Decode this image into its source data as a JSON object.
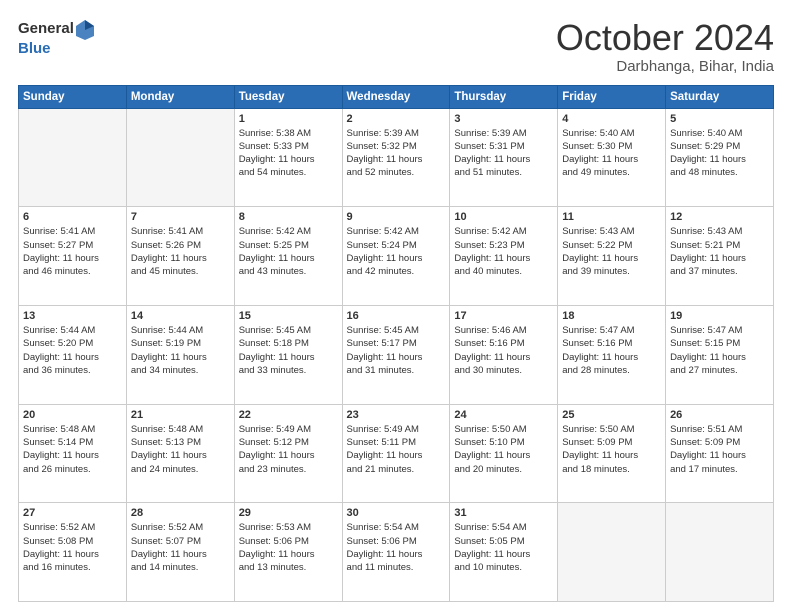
{
  "header": {
    "logo_general": "General",
    "logo_blue": "Blue",
    "month": "October 2024",
    "location": "Darbhanga, Bihar, India"
  },
  "weekdays": [
    "Sunday",
    "Monday",
    "Tuesday",
    "Wednesday",
    "Thursday",
    "Friday",
    "Saturday"
  ],
  "weeks": [
    [
      {
        "day": "",
        "info": ""
      },
      {
        "day": "",
        "info": ""
      },
      {
        "day": "1",
        "info": "Sunrise: 5:38 AM\nSunset: 5:33 PM\nDaylight: 11 hours\nand 54 minutes."
      },
      {
        "day": "2",
        "info": "Sunrise: 5:39 AM\nSunset: 5:32 PM\nDaylight: 11 hours\nand 52 minutes."
      },
      {
        "day": "3",
        "info": "Sunrise: 5:39 AM\nSunset: 5:31 PM\nDaylight: 11 hours\nand 51 minutes."
      },
      {
        "day": "4",
        "info": "Sunrise: 5:40 AM\nSunset: 5:30 PM\nDaylight: 11 hours\nand 49 minutes."
      },
      {
        "day": "5",
        "info": "Sunrise: 5:40 AM\nSunset: 5:29 PM\nDaylight: 11 hours\nand 48 minutes."
      }
    ],
    [
      {
        "day": "6",
        "info": "Sunrise: 5:41 AM\nSunset: 5:27 PM\nDaylight: 11 hours\nand 46 minutes."
      },
      {
        "day": "7",
        "info": "Sunrise: 5:41 AM\nSunset: 5:26 PM\nDaylight: 11 hours\nand 45 minutes."
      },
      {
        "day": "8",
        "info": "Sunrise: 5:42 AM\nSunset: 5:25 PM\nDaylight: 11 hours\nand 43 minutes."
      },
      {
        "day": "9",
        "info": "Sunrise: 5:42 AM\nSunset: 5:24 PM\nDaylight: 11 hours\nand 42 minutes."
      },
      {
        "day": "10",
        "info": "Sunrise: 5:42 AM\nSunset: 5:23 PM\nDaylight: 11 hours\nand 40 minutes."
      },
      {
        "day": "11",
        "info": "Sunrise: 5:43 AM\nSunset: 5:22 PM\nDaylight: 11 hours\nand 39 minutes."
      },
      {
        "day": "12",
        "info": "Sunrise: 5:43 AM\nSunset: 5:21 PM\nDaylight: 11 hours\nand 37 minutes."
      }
    ],
    [
      {
        "day": "13",
        "info": "Sunrise: 5:44 AM\nSunset: 5:20 PM\nDaylight: 11 hours\nand 36 minutes."
      },
      {
        "day": "14",
        "info": "Sunrise: 5:44 AM\nSunset: 5:19 PM\nDaylight: 11 hours\nand 34 minutes."
      },
      {
        "day": "15",
        "info": "Sunrise: 5:45 AM\nSunset: 5:18 PM\nDaylight: 11 hours\nand 33 minutes."
      },
      {
        "day": "16",
        "info": "Sunrise: 5:45 AM\nSunset: 5:17 PM\nDaylight: 11 hours\nand 31 minutes."
      },
      {
        "day": "17",
        "info": "Sunrise: 5:46 AM\nSunset: 5:16 PM\nDaylight: 11 hours\nand 30 minutes."
      },
      {
        "day": "18",
        "info": "Sunrise: 5:47 AM\nSunset: 5:16 PM\nDaylight: 11 hours\nand 28 minutes."
      },
      {
        "day": "19",
        "info": "Sunrise: 5:47 AM\nSunset: 5:15 PM\nDaylight: 11 hours\nand 27 minutes."
      }
    ],
    [
      {
        "day": "20",
        "info": "Sunrise: 5:48 AM\nSunset: 5:14 PM\nDaylight: 11 hours\nand 26 minutes."
      },
      {
        "day": "21",
        "info": "Sunrise: 5:48 AM\nSunset: 5:13 PM\nDaylight: 11 hours\nand 24 minutes."
      },
      {
        "day": "22",
        "info": "Sunrise: 5:49 AM\nSunset: 5:12 PM\nDaylight: 11 hours\nand 23 minutes."
      },
      {
        "day": "23",
        "info": "Sunrise: 5:49 AM\nSunset: 5:11 PM\nDaylight: 11 hours\nand 21 minutes."
      },
      {
        "day": "24",
        "info": "Sunrise: 5:50 AM\nSunset: 5:10 PM\nDaylight: 11 hours\nand 20 minutes."
      },
      {
        "day": "25",
        "info": "Sunrise: 5:50 AM\nSunset: 5:09 PM\nDaylight: 11 hours\nand 18 minutes."
      },
      {
        "day": "26",
        "info": "Sunrise: 5:51 AM\nSunset: 5:09 PM\nDaylight: 11 hours\nand 17 minutes."
      }
    ],
    [
      {
        "day": "27",
        "info": "Sunrise: 5:52 AM\nSunset: 5:08 PM\nDaylight: 11 hours\nand 16 minutes."
      },
      {
        "day": "28",
        "info": "Sunrise: 5:52 AM\nSunset: 5:07 PM\nDaylight: 11 hours\nand 14 minutes."
      },
      {
        "day": "29",
        "info": "Sunrise: 5:53 AM\nSunset: 5:06 PM\nDaylight: 11 hours\nand 13 minutes."
      },
      {
        "day": "30",
        "info": "Sunrise: 5:54 AM\nSunset: 5:06 PM\nDaylight: 11 hours\nand 11 minutes."
      },
      {
        "day": "31",
        "info": "Sunrise: 5:54 AM\nSunset: 5:05 PM\nDaylight: 11 hours\nand 10 minutes."
      },
      {
        "day": "",
        "info": ""
      },
      {
        "day": "",
        "info": ""
      }
    ]
  ]
}
